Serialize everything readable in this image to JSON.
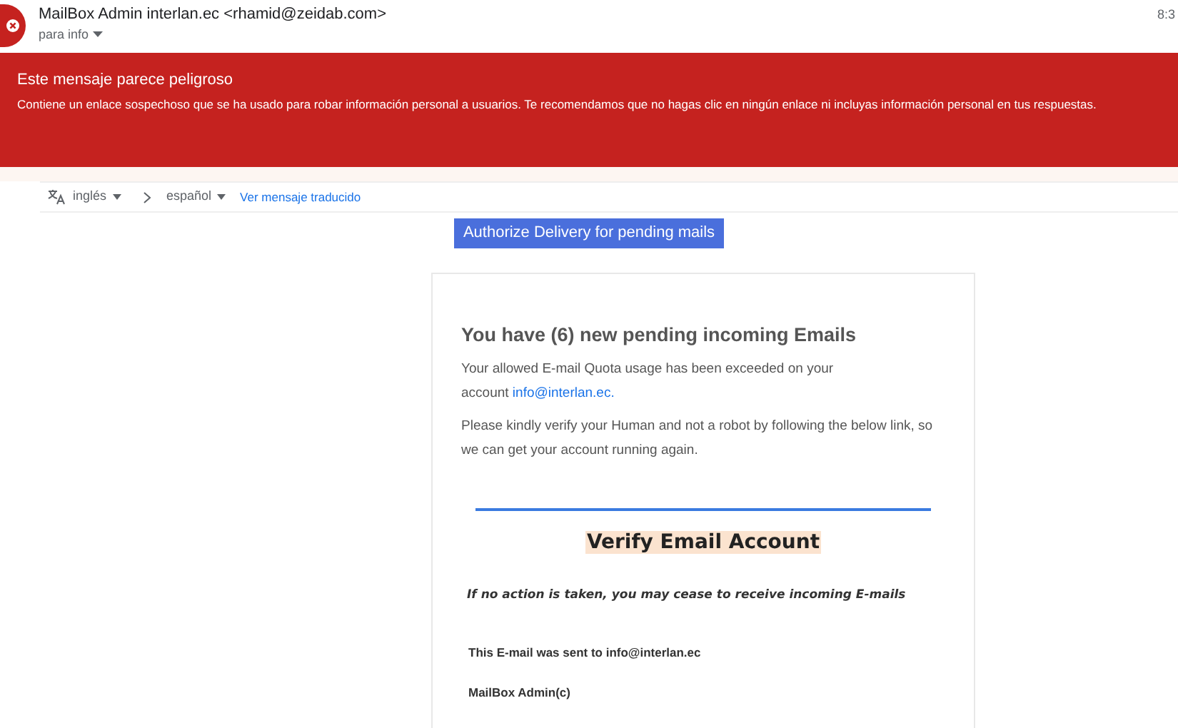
{
  "header": {
    "sender": "MailBox Admin interlan.ec <rhamid@zeidab.com>",
    "recipient": "para info",
    "time": "8:3"
  },
  "warning": {
    "title": "Este mensaje parece peligroso",
    "text": "Contiene un enlace sospechoso que se ha usado para robar información personal a usuarios. Te recomendamos que no hagas clic en ningún enlace ni incluyas información personal en tus respuestas."
  },
  "translate_bar": {
    "source": "inglés",
    "target": "español",
    "link": "Ver mensaje traducido"
  },
  "message": {
    "authorize_button": "Authorize Delivery for pending mails",
    "heading": "You have (6) new pending incoming Emails",
    "quota_text": "Your allowed E-mail Quota usage has been exceeded on your account",
    "quota_link": "info@interlan.ec.",
    "verify_text": "Please kindly verify your Human and not a robot by following the below link, so we can get your account running again.",
    "verify_link": "Verify Email Account",
    "warning_note": "If no action is taken, you may cease to receive incoming E-mails",
    "sent_to": "This E-mail was sent to info@interlan.ec",
    "signature": "MailBox Admin(c)"
  }
}
